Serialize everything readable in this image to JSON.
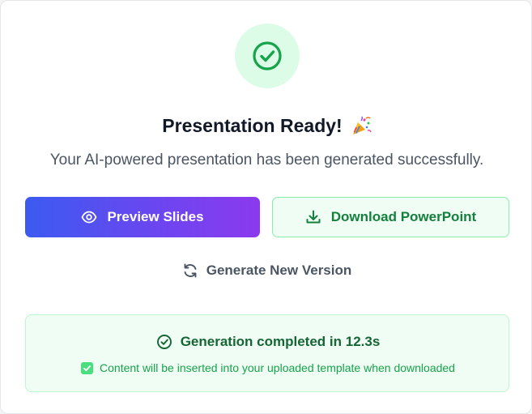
{
  "header": {
    "title": "Presentation Ready!",
    "subtitle": "Your AI-powered presentation has been generated successfully.",
    "icon": "check-circle-icon",
    "emoji_icon": "party-popper-icon"
  },
  "actions": {
    "preview_label": "Preview Slides",
    "preview_icon": "eye-icon",
    "download_label": "Download PowerPoint",
    "download_icon": "download-icon",
    "regenerate_label": "Generate New Version",
    "regenerate_icon": "refresh-icon"
  },
  "status": {
    "completed_text": "Generation completed in 12.3s",
    "completed_icon": "check-circle-icon",
    "note_text": "Content will be inserted into your uploaded template when downloaded",
    "note_icon": "checkbox-checked-icon"
  },
  "colors": {
    "success_green": "#16a34a",
    "success_bg": "#f0fdf4",
    "gradient_start": "#3b5bf0",
    "gradient_end": "#8b3aee"
  }
}
